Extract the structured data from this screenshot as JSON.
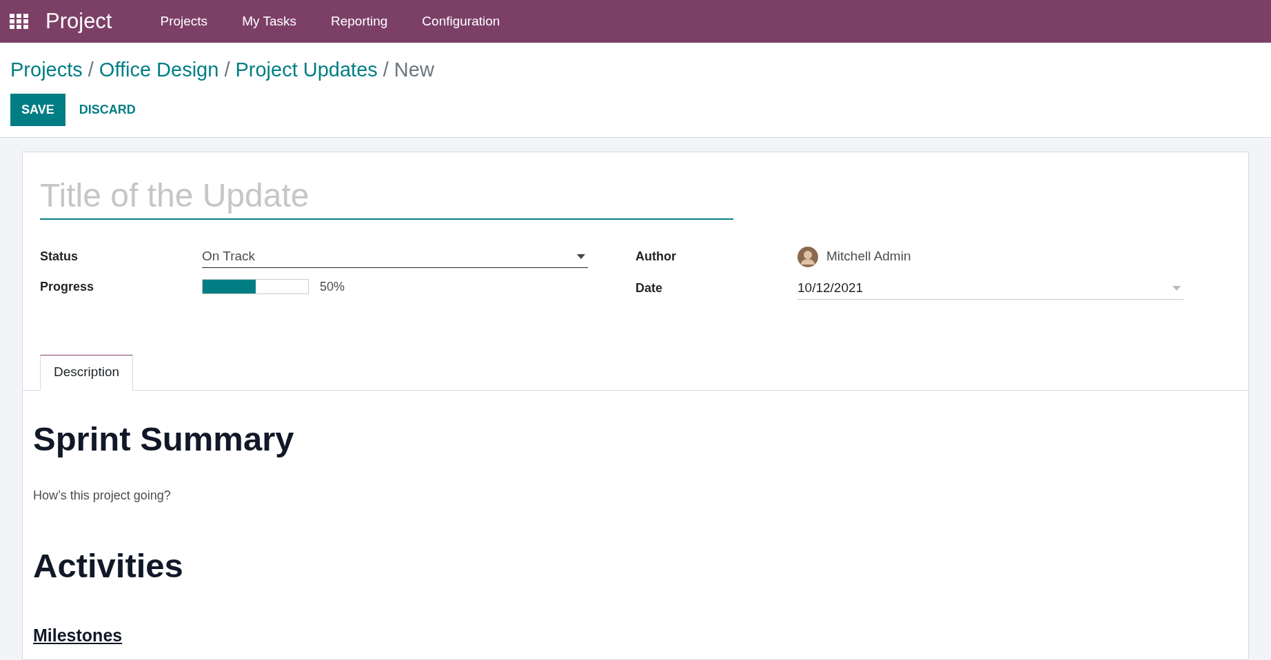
{
  "navbar": {
    "app_name": "Project",
    "menu": [
      "Projects",
      "My Tasks",
      "Reporting",
      "Configuration"
    ]
  },
  "breadcrumb_separator": "/",
  "breadcrumb": [
    {
      "label": "Projects",
      "kind": "link"
    },
    {
      "label": "Office Design",
      "kind": "link"
    },
    {
      "label": "Project Updates",
      "kind": "link"
    },
    {
      "label": "New",
      "kind": "current"
    }
  ],
  "buttons": [
    {
      "label": "SAVE",
      "kind": "primary"
    },
    {
      "label": "DISCARD",
      "kind": "secondary"
    }
  ],
  "title_field": {
    "placeholder": "Title of the Update"
  },
  "fields_left": [
    {
      "label": "Status",
      "kind": "select",
      "value": "On Track"
    },
    {
      "label": "Progress",
      "kind": "progress",
      "level": 0.5,
      "reading": "50%"
    }
  ],
  "fields_right": [
    {
      "label": "Author",
      "kind": "user",
      "value": "Mitchell Admin"
    },
    {
      "label": "Date",
      "kind": "date",
      "value": "10/12/2021"
    }
  ],
  "tabs": [
    {
      "label": "Description",
      "selected": true
    }
  ],
  "content": [
    {
      "kind": "h1",
      "text": "Sprint Summary"
    },
    {
      "kind": "p",
      "text": "How’s this project going?"
    },
    {
      "kind": "h1",
      "text": "Activities"
    },
    {
      "kind": "h3",
      "text": "Milestones"
    }
  ]
}
